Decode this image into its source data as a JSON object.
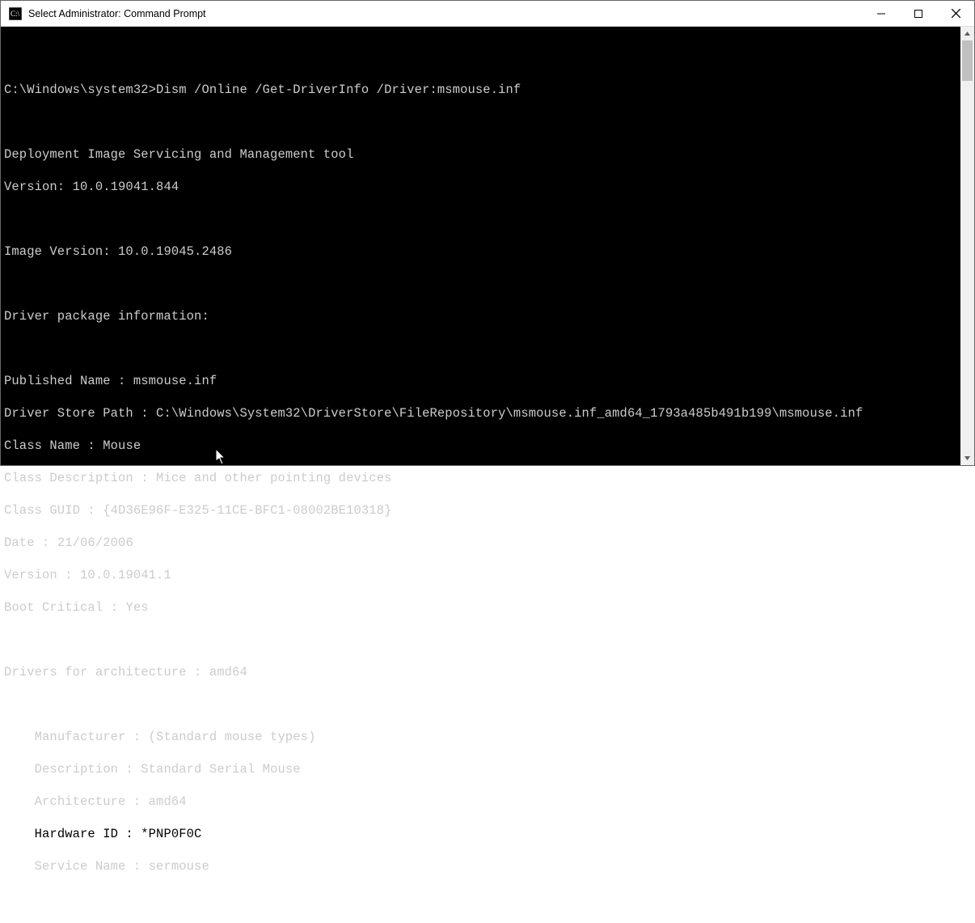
{
  "window": {
    "title": "Select Administrator: Command Prompt"
  },
  "prompt": {
    "path": "C:\\Windows\\system32>",
    "command": "Dism /Online /Get-DriverInfo /Driver:msmouse.inf"
  },
  "output": {
    "tool_heading": "Deployment Image Servicing and Management tool",
    "tool_version_label": "Version:",
    "tool_version": "10.0.19041.844",
    "image_version_label": "Image Version:",
    "image_version": "10.0.19045.2486",
    "pkg_info_heading": "Driver package information:",
    "published_name_label": "Published Name :",
    "published_name": "msmouse.inf",
    "store_path_label": "Driver Store Path :",
    "store_path": "C:\\Windows\\System32\\DriverStore\\FileRepository\\msmouse.inf_amd64_1793a485b491b199\\msmouse.inf",
    "class_name_label": "Class Name :",
    "class_name": "Mouse",
    "class_desc_label": "Class Description :",
    "class_desc": "Mice and other pointing devices",
    "class_guid_label": "Class GUID :",
    "class_guid": "{4D36E96F-E325-11CE-BFC1-08002BE10318}",
    "date_label": "Date :",
    "date": "21/06/2006",
    "version_label": "Version :",
    "version": "10.0.19041.1",
    "boot_critical_label": "Boot Critical :",
    "boot_critical": "Yes",
    "arch_heading_label": "Drivers for architecture :",
    "arch_heading_value": "amd64",
    "driver": {
      "manufacturer_label": "Manufacturer :",
      "manufacturer": "(Standard mouse types)",
      "description_label": "Description :",
      "description": "Standard Serial Mouse",
      "architecture_label": "Architecture :",
      "architecture": "amd64",
      "hardware_id_label": "Hardware ID :",
      "hardware_id": "*PNP0F0C",
      "service_name_label": "Service Name :",
      "service_name": "sermouse"
    }
  }
}
